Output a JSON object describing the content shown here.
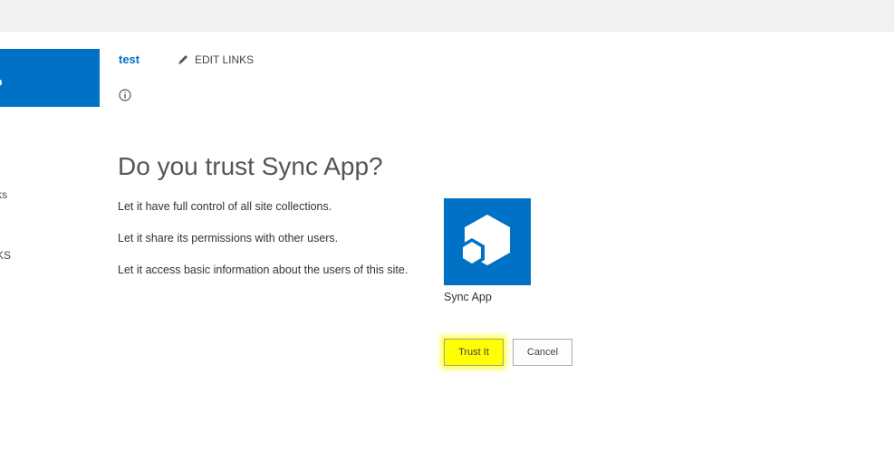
{
  "header": {
    "site_title": "test",
    "edit_links_label": "EDIT LINKS"
  },
  "left_nav": {
    "logo_fragment": "o",
    "fragment_1": "ks",
    "fragment_2": "KS"
  },
  "dialog": {
    "title": "Do you trust Sync App?",
    "permissions": [
      "Let it have full control of all site collections.",
      "Let it share its permissions with other users.",
      "Let it access basic information about the users of this site."
    ],
    "app_name": "Sync App",
    "trust_button_label": "Trust It",
    "cancel_button_label": "Cancel"
  },
  "colors": {
    "brand_blue": "#0072c6",
    "highlight": "#ffff00",
    "top_bar": "#f1f1f1"
  },
  "icons": {
    "edit": "pencil-icon",
    "info": "info-icon",
    "app": "hexagon-cubes-icon"
  }
}
